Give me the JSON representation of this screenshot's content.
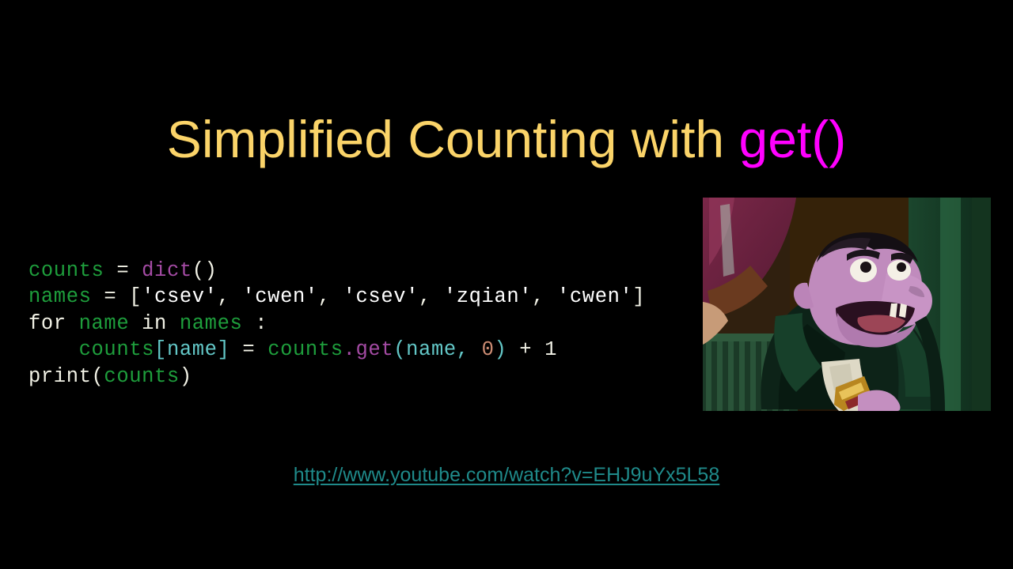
{
  "slide": {
    "background_color": "#000000",
    "title": {
      "main_text": "Simplified Counting with ",
      "accent_text": "get()",
      "main_color": "#FBD469",
      "accent_color": "#FF00FF"
    },
    "code": {
      "lines": [
        [
          {
            "t": "counts",
            "c": "c-var"
          },
          {
            "t": " = ",
            "c": "c-plain"
          },
          {
            "t": "dict",
            "c": "c-fn"
          },
          {
            "t": "()",
            "c": "c-plain"
          }
        ],
        [
          {
            "t": "names",
            "c": "c-var"
          },
          {
            "t": " = [",
            "c": "c-plain"
          },
          {
            "t": "'csev'",
            "c": "c-str"
          },
          {
            "t": ", ",
            "c": "c-plain"
          },
          {
            "t": "'cwen'",
            "c": "c-str"
          },
          {
            "t": ", ",
            "c": "c-plain"
          },
          {
            "t": "'csev'",
            "c": "c-str"
          },
          {
            "t": ", ",
            "c": "c-plain"
          },
          {
            "t": "'zqian'",
            "c": "c-str"
          },
          {
            "t": ", ",
            "c": "c-plain"
          },
          {
            "t": "'cwen'",
            "c": "c-str"
          },
          {
            "t": "]",
            "c": "c-plain"
          }
        ],
        [
          {
            "t": "for ",
            "c": "c-plain"
          },
          {
            "t": "name",
            "c": "c-var"
          },
          {
            "t": " in ",
            "c": "c-plain"
          },
          {
            "t": "names",
            "c": "c-var"
          },
          {
            "t": " :",
            "c": "c-plain"
          }
        ],
        [
          {
            "t": "    ",
            "c": "c-plain"
          },
          {
            "t": "counts",
            "c": "c-var"
          },
          {
            "t": "[name]",
            "c": "c-arg"
          },
          {
            "t": " = ",
            "c": "c-plain"
          },
          {
            "t": "counts",
            "c": "c-var"
          },
          {
            "t": ".",
            "c": "c-fn"
          },
          {
            "t": "get",
            "c": "c-fn"
          },
          {
            "t": "(name, ",
            "c": "c-arg"
          },
          {
            "t": "0",
            "c": "c-num"
          },
          {
            "t": ")",
            "c": "c-arg"
          },
          {
            "t": " + 1",
            "c": "c-plain"
          }
        ],
        [
          {
            "t": "print",
            "c": "c-plain"
          },
          {
            "t": "(",
            "c": "c-plain"
          },
          {
            "t": "counts",
            "c": "c-var"
          },
          {
            "t": ")",
            "c": "c-plain"
          }
        ]
      ],
      "plain_text": "counts = dict()\nnames = ['csev', 'cwen', 'csev', 'zqian', 'cwen']\nfor name in names :\n    counts[name] = counts.get(name, 0) + 1\nprint(counts)",
      "colors": {
        "identifier_green": "#1E9E3C",
        "default_white": "#F2F2E6",
        "string_white": "#FFFFFF",
        "function_purple": "#A44BA4",
        "argument_cyan": "#63C7C7",
        "number_salmon": "#CC8C73"
      }
    },
    "photo": {
      "alt": "Count von Count from Sesame Street counting",
      "name": "count-von-count-photo"
    },
    "link": {
      "label": "http://www.youtube.com/watch?v=EHJ9uYx5L58",
      "color": "#1F8A8A"
    }
  }
}
